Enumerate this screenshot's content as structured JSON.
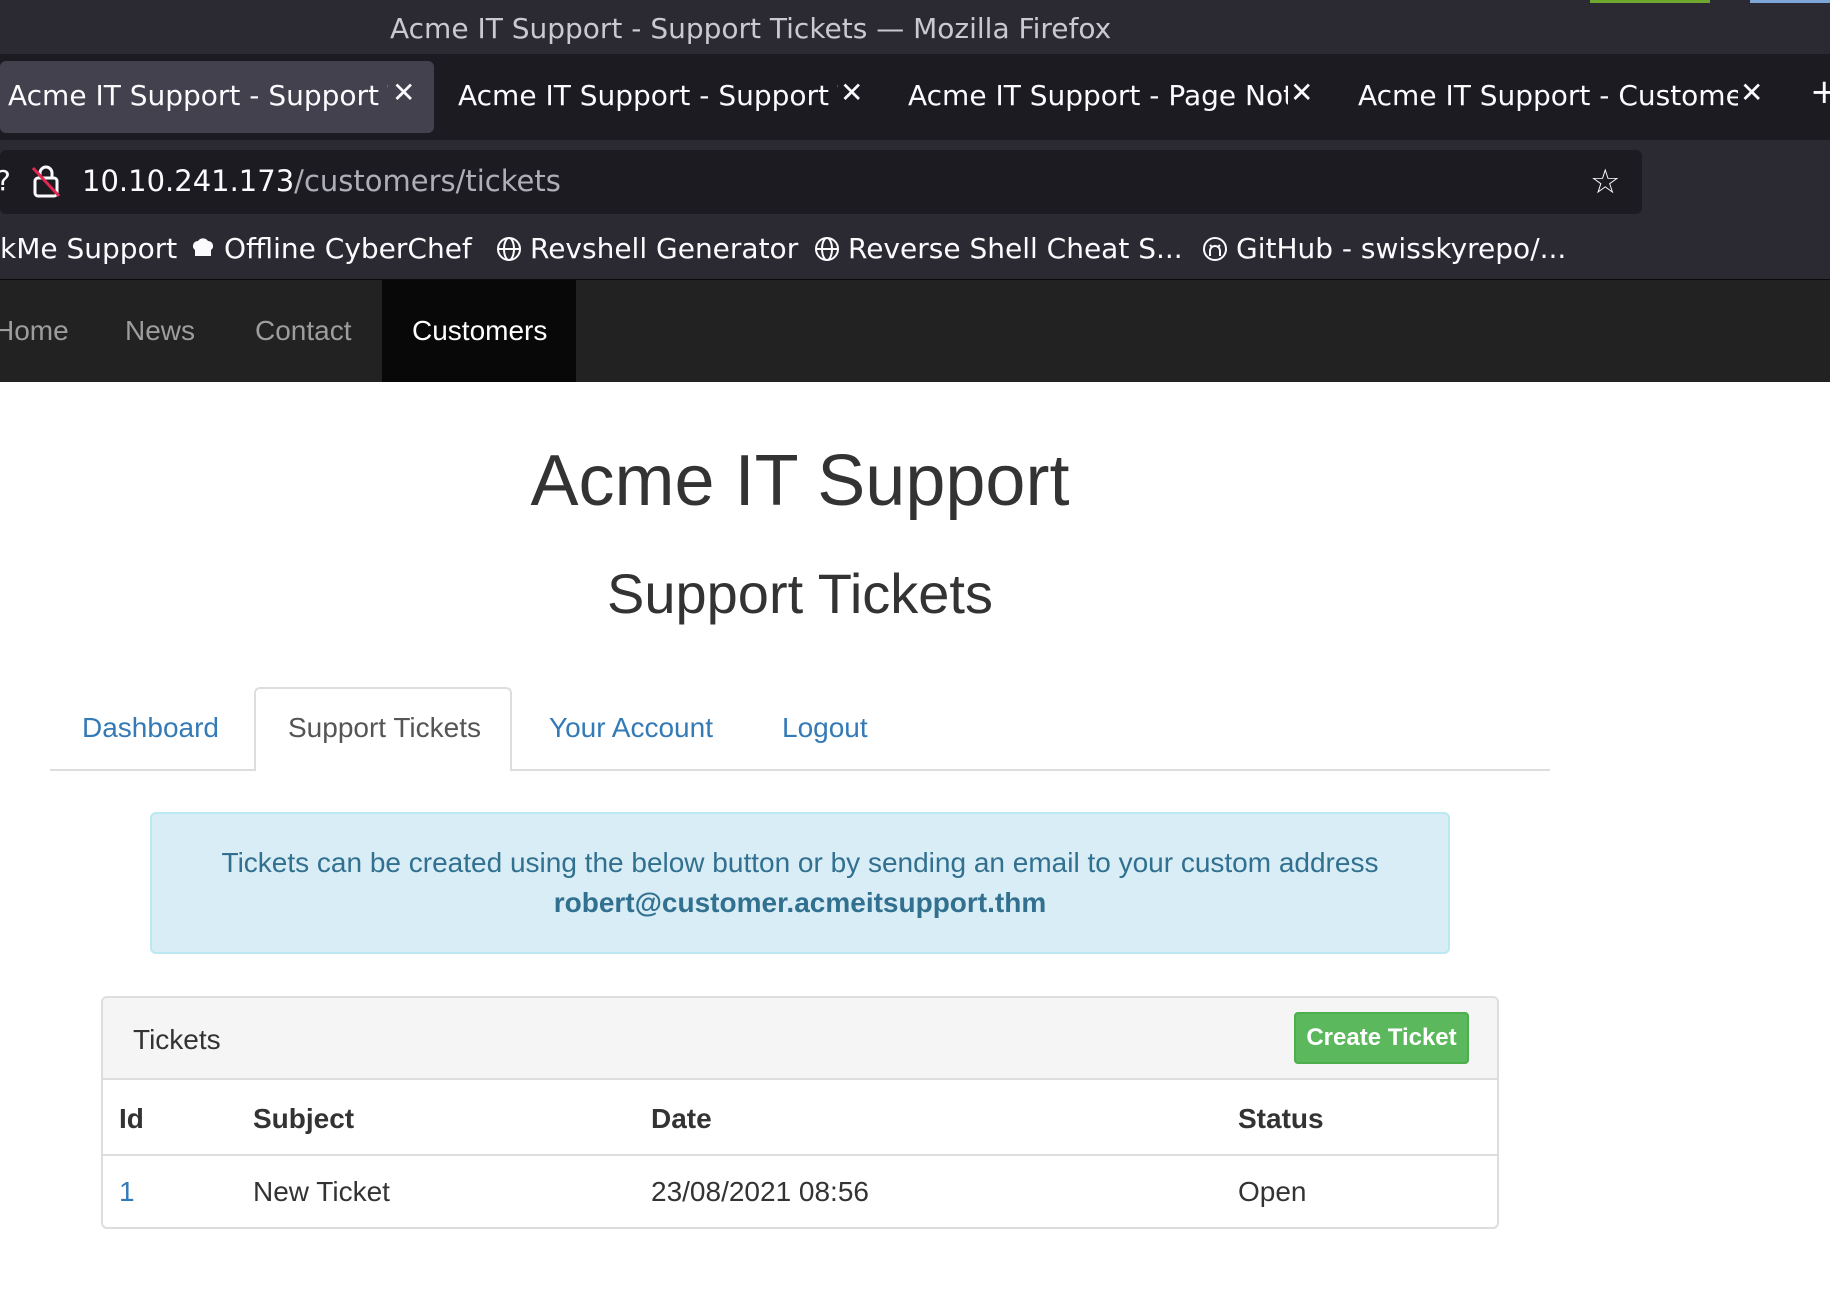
{
  "window": {
    "title": "Acme IT Support - Support Tickets — Mozilla Firefox"
  },
  "tabs": [
    {
      "label": "Acme IT Support - Support Ti",
      "active": true
    },
    {
      "label": "Acme IT Support - Support Ti",
      "active": false
    },
    {
      "label": "Acme IT Support - Page Not F",
      "active": false
    },
    {
      "label": "Acme IT Support - Customer",
      "active": false
    }
  ],
  "urlbar": {
    "host": "10.10.241.173",
    "path": "/customers/tickets"
  },
  "bookmarks": [
    {
      "label": "kMe Support"
    },
    {
      "label": "Offline CyberChef"
    },
    {
      "label": "Revshell Generator"
    },
    {
      "label": "Reverse Shell Cheat S..."
    },
    {
      "label": "GitHub - swisskyrepo/..."
    }
  ],
  "site_nav": {
    "items": [
      "Home",
      "News",
      "Contact",
      "Customers"
    ],
    "active": "Customers"
  },
  "page": {
    "title": "Acme IT Support",
    "subtitle": "Support Tickets",
    "tabs": [
      "Dashboard",
      "Support Tickets",
      "Your Account",
      "Logout"
    ],
    "active_tab": "Support Tickets",
    "alert": {
      "text": "Tickets can be created using the below button or by sending an email to your custom address",
      "email": "robert@customer.acmeitsupport.thm"
    },
    "panel": {
      "heading": "Tickets",
      "create_button": "Create Ticket",
      "columns": [
        "Id",
        "Subject",
        "Date",
        "Status"
      ],
      "rows": [
        {
          "id": "1",
          "subject": "New Ticket",
          "date": "23/08/2021 08:56",
          "status": "Open"
        }
      ]
    }
  },
  "colors": {
    "brand_nav": "#222222",
    "link": "#337ab7",
    "alert_bg": "#d9edf7",
    "success": "#5cb85c"
  }
}
